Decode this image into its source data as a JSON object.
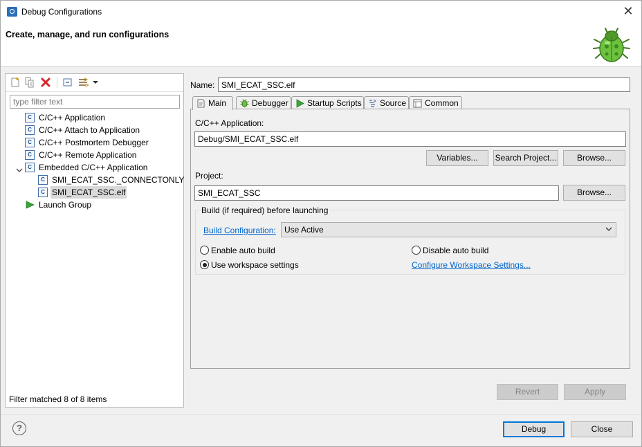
{
  "window": {
    "title": "Debug Configurations",
    "close_glyph": "✕"
  },
  "banner": {
    "title": "Create, manage, and run configurations",
    "icon": "debug-bug-icon"
  },
  "left": {
    "toolbar_icons": [
      "new-configuration-icon",
      "duplicate-icon",
      "delete-icon",
      "collapse-all-icon",
      "filter-icon",
      "dropdown-arrow-icon"
    ],
    "filter_placeholder": "type filter text",
    "tree": [
      {
        "label": "C/C++ Application",
        "icon": "c-config-icon"
      },
      {
        "label": "C/C++ Attach to Application",
        "icon": "c-config-icon"
      },
      {
        "label": "C/C++ Postmortem Debugger",
        "icon": "c-config-icon"
      },
      {
        "label": "C/C++ Remote Application",
        "icon": "c-config-icon"
      },
      {
        "label": "Embedded C/C++ Application",
        "icon": "c-config-icon",
        "expanded": true
      },
      {
        "label": "SMI_ECAT_SSC._CONNECTONLY",
        "icon": "c-config-icon"
      },
      {
        "label": "SMI_ECAT_SSC.elf",
        "icon": "c-config-icon",
        "selected": true
      },
      {
        "label": "Launch Group",
        "icon": "launch-group-icon"
      }
    ],
    "status": "Filter matched 8 of 8 items"
  },
  "config": {
    "name_label": "Name:",
    "name_value": "SMI_ECAT_SSC.elf",
    "tabs": [
      {
        "label": "Main",
        "icon": "main-tab-icon"
      },
      {
        "label": "Debugger",
        "icon": "debugger-tab-icon"
      },
      {
        "label": "Startup Scripts",
        "icon": "startup-tab-icon"
      },
      {
        "label": "Source",
        "icon": "source-tab-icon"
      },
      {
        "label": "Common",
        "icon": "common-tab-icon"
      }
    ],
    "active_tab": "Main",
    "main": {
      "app_label": "C/C++ Application:",
      "app_value": "Debug/SMI_ECAT_SSC.elf",
      "variables_btn": "Variables...",
      "search_project_btn": "Search Project...",
      "browse_btn": "Browse...",
      "project_label": "Project:",
      "project_value": "SMI_ECAT_SSC",
      "project_browse_btn": "Browse...",
      "build_group_title": "Build (if required) before launching",
      "build_config_link": "Build Configuration:",
      "build_config_value": "Use Active",
      "enable_auto_build": "Enable auto build",
      "disable_auto_build": "Disable auto build",
      "use_workspace_settings": "Use workspace settings",
      "configure_workspace_link": "Configure Workspace Settings...",
      "selected_build_option": "use_workspace_settings"
    },
    "revert_btn": "Revert",
    "apply_btn": "Apply"
  },
  "footer": {
    "help_glyph": "?",
    "debug_btn": "Debug",
    "close_btn": "Close"
  },
  "colors": {
    "link": "#0066cc",
    "default_button_border": "#0078d7",
    "delete_red": "#d9262b",
    "bug_green": "#5aa832"
  }
}
